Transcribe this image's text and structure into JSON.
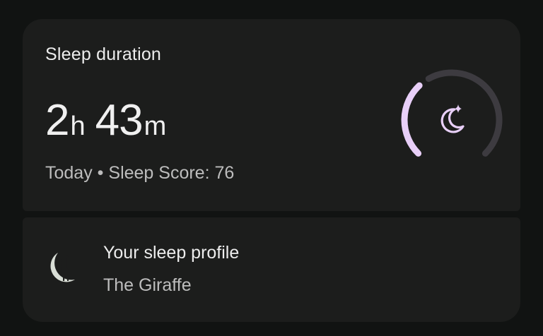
{
  "sleep_card": {
    "title": "Sleep duration",
    "hours": "2",
    "hours_unit": "h",
    "minutes": "43",
    "minutes_unit": "m",
    "day": "Today",
    "separator": "•",
    "score_label": "Sleep Score: 76",
    "ring": {
      "progress_fraction": 0.34,
      "accent_color": "#e8cff8",
      "track_color": "#3d3b40",
      "icon": "moon-star-icon"
    }
  },
  "profile_card": {
    "title": "Your sleep profile",
    "profile_name": "The Giraffe",
    "icon": "giraffe-moon-icon",
    "icon_color": "#d9ded6"
  }
}
